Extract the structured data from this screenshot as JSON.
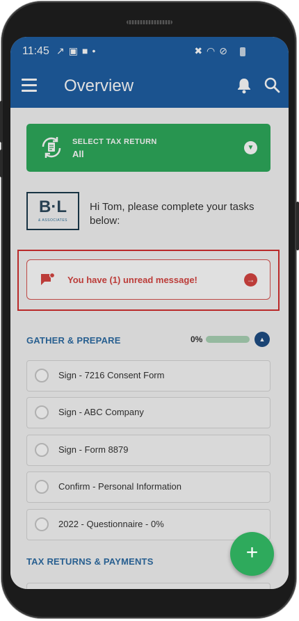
{
  "status_bar": {
    "time": "11:45",
    "left_icons": [
      "missed-call-icon",
      "image-icon",
      "square-app-icon",
      "dot-icon"
    ],
    "right_icons": [
      "mute-icon",
      "wifi-icon",
      "do-not-disturb-icon",
      "battery-icon"
    ]
  },
  "appbar": {
    "title": "Overview"
  },
  "select_tax_return": {
    "label": "SELECT TAX RETURN",
    "value": "All"
  },
  "firm": {
    "logo_letters": "B·L",
    "logo_sub": "& ASSOCIATES"
  },
  "greeting": "Hi Tom, please complete your tasks below:",
  "message_banner": {
    "text": "You have (1) unread message!"
  },
  "gather_prepare": {
    "title": "GATHER & PREPARE",
    "progress_label": "0%",
    "progress_fraction": 0
  },
  "tasks": [
    {
      "label": "Sign - 7216 Consent Form"
    },
    {
      "label": "Sign - ABC Company"
    },
    {
      "label": "Sign - Form 8879"
    },
    {
      "label": "Confirm - Personal Information"
    },
    {
      "label": "2022 - Questionnaire - 0%"
    }
  ],
  "tax_returns_payments": {
    "title": "TAX RETURNS & PAYMENTS"
  },
  "fab": {
    "label": "+"
  },
  "colors": {
    "appbar": "#1f5fa3",
    "accent_green": "#2eaa5c",
    "alert_red": "#d64541",
    "section_blue": "#2e6da4"
  }
}
